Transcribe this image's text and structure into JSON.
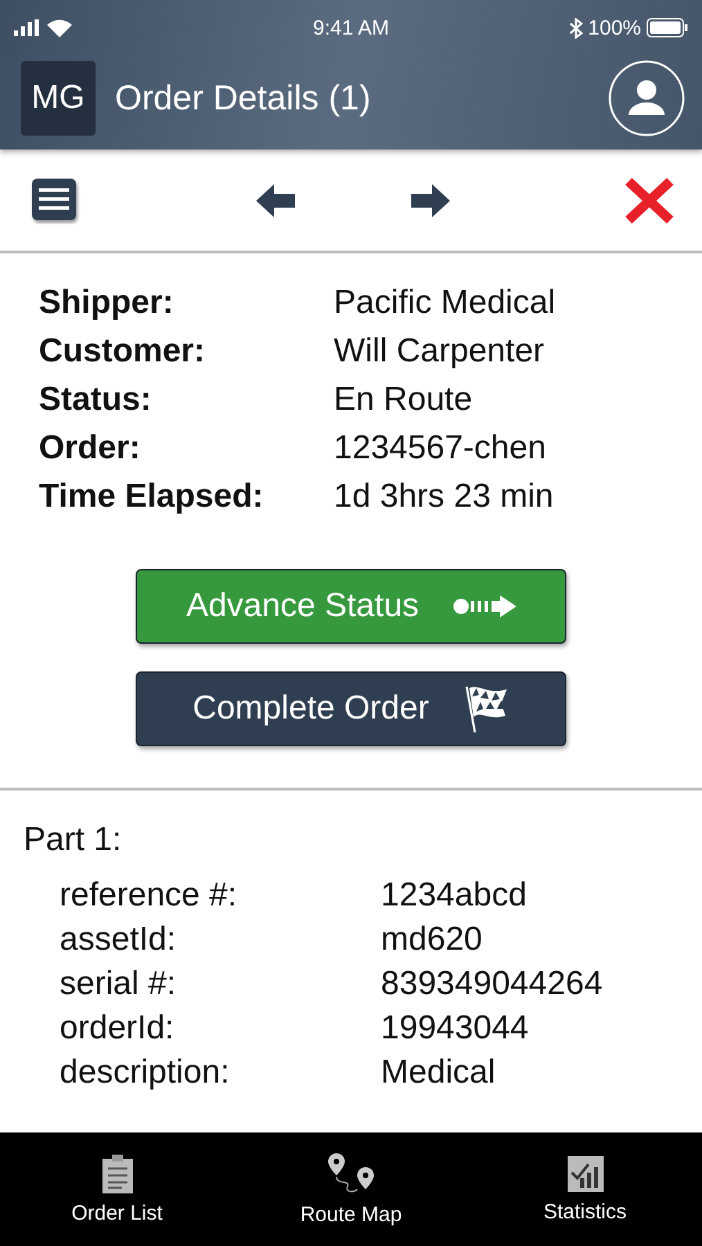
{
  "status_bar": {
    "time": "9:41 AM",
    "battery": "100%"
  },
  "header": {
    "badge": "MG",
    "title": "Order Details (1)"
  },
  "details": [
    {
      "label": "Shipper:",
      "value": "Pacific Medical"
    },
    {
      "label": "Customer:",
      "value": "Will Carpenter"
    },
    {
      "label": "Status:",
      "value": "En Route"
    },
    {
      "label": "Order:",
      "value": "1234567-chen"
    },
    {
      "label": "Time Elapsed:",
      "value": "1d 3hrs 23 min"
    }
  ],
  "actions": [
    {
      "kind": "advance",
      "label": "Advance Status"
    },
    {
      "kind": "complete",
      "label": "Complete Order"
    }
  ],
  "part": {
    "title": "Part 1:",
    "fields": [
      {
        "label": "reference #:",
        "value": "1234abcd"
      },
      {
        "label": "assetId:",
        "value": "md620"
      },
      {
        "label": "serial #:",
        "value": "839349044264"
      },
      {
        "label": "orderId:",
        "value": "19943044"
      },
      {
        "label": "description:",
        "value": "Medical"
      }
    ]
  },
  "tabs": [
    {
      "kind": "list",
      "label": "Order List"
    },
    {
      "kind": "map",
      "label": "Route Map"
    },
    {
      "kind": "stats",
      "label": "Statistics"
    }
  ]
}
